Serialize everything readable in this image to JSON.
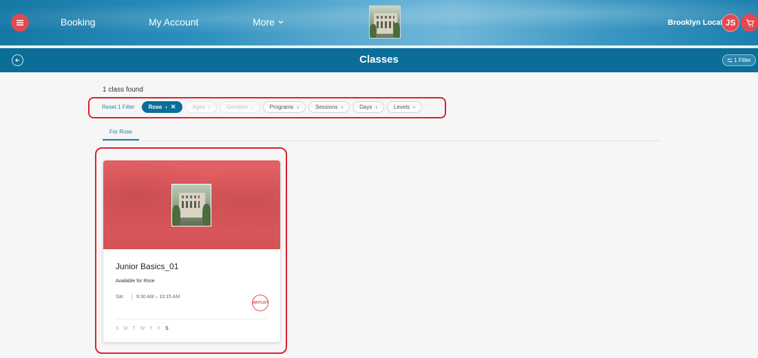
{
  "header": {
    "nav": {
      "booking": "Booking",
      "account": "My Account",
      "more": "More"
    },
    "location": "Brooklyn Location",
    "user_initials": "JS"
  },
  "subheader": {
    "title": "Classes",
    "filter_button": "1 Filter"
  },
  "results": {
    "count_text": "1 class found",
    "reset_label": "Reset 1 Filter",
    "chips": [
      {
        "label": "Rose",
        "state": "active"
      },
      {
        "label": "Ages",
        "state": "disabled"
      },
      {
        "label": "Genders",
        "state": "disabled"
      },
      {
        "label": "Programs",
        "state": "normal"
      },
      {
        "label": "Sessions",
        "state": "normal"
      },
      {
        "label": "Days",
        "state": "normal"
      },
      {
        "label": "Levels",
        "state": "normal"
      }
    ],
    "tab_label": "For Rose"
  },
  "class_card": {
    "title": "Junior Basics_01",
    "availability": "Available for Rose",
    "day": "Sat",
    "time": "9:30 AM – 10:15 AM",
    "status_badge": "WAITLIST",
    "weekdays": [
      "S",
      "M",
      "T",
      "W",
      "T",
      "F",
      "S"
    ],
    "active_day_index": 6
  },
  "colors": {
    "primary": "#0b6e99",
    "accent": "#e2494f",
    "highlight_outline": "#d91e2c"
  }
}
